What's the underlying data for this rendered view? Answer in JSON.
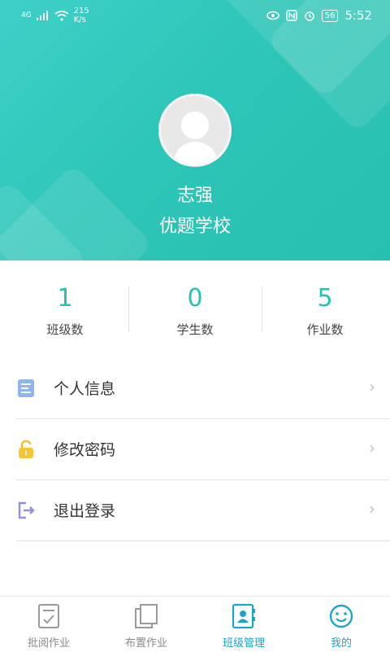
{
  "status_bar": {
    "network": "4G",
    "speed_value": "215",
    "speed_unit": "K/s",
    "battery": "56",
    "time": "5:52"
  },
  "profile": {
    "name": "志强",
    "school": "优题学校"
  },
  "stats": [
    {
      "value": "1",
      "label": "班级数"
    },
    {
      "value": "0",
      "label": "学生数"
    },
    {
      "value": "5",
      "label": "作业数"
    }
  ],
  "menu": [
    {
      "label": "个人信息",
      "icon": "document-icon"
    },
    {
      "label": "修改密码",
      "icon": "lock-icon"
    },
    {
      "label": "退出登录",
      "icon": "logout-icon"
    }
  ],
  "tabbar": [
    {
      "label": "批阅作业",
      "icon": "grade-homework-icon"
    },
    {
      "label": "布置作业",
      "icon": "assign-homework-icon"
    },
    {
      "label": "班级管理",
      "icon": "class-management-icon"
    },
    {
      "label": "我的",
      "icon": "profile-smile-icon"
    }
  ],
  "colors": {
    "header": "#2ec6b8",
    "stat_number": "#28bfb4",
    "tab_active": "#1aa6c8"
  }
}
